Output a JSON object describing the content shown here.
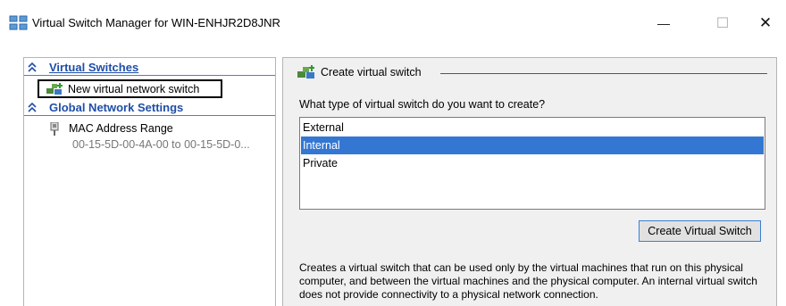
{
  "window": {
    "title": "Virtual Switch Manager for WIN-ENHJR2D8JNR",
    "minimize_glyph": "—",
    "maximize_glyph": "☐",
    "close_glyph": "✕",
    "icon": "virtual-switch-manager-icon"
  },
  "left_pane": {
    "virtual_switches": {
      "header": "Virtual Switches",
      "items": [
        {
          "label": "New virtual network switch",
          "icon": "network-switch-add-icon"
        }
      ]
    },
    "global_settings": {
      "header": "Global Network Settings",
      "items": [
        {
          "label": "MAC Address Range",
          "value": "00-15-5D-00-4A-00 to 00-15-5D-0...",
          "icon": "network-adapter-icon"
        }
      ]
    }
  },
  "right_pane": {
    "group_title": "Create virtual switch",
    "group_icon": "network-switch-add-icon",
    "question": "What type of virtual switch do you want to create?",
    "types": [
      "External",
      "Internal",
      "Private"
    ],
    "selected_type": "Internal",
    "create_button": "Create Virtual Switch",
    "description": "Creates a virtual switch that can be used only by the virtual machines that run on this physical computer, and between the virtual machines and the physical computer. An internal virtual switch does not provide connectivity to a physical network connection."
  },
  "colors": {
    "selection": "#3377d3",
    "header_text": "#1f4ea8",
    "header_rule": "#4a7fd6",
    "pane_background": "#f0f0f0"
  }
}
